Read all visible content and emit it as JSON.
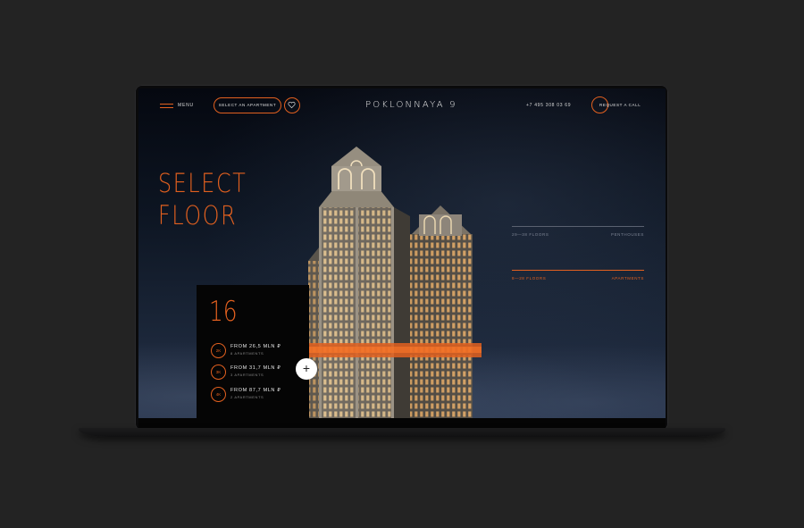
{
  "header": {
    "menu_label": "MENU",
    "select_apartment_label": "SELECT AN APARTMENT",
    "favorites_icon": "heart-icon",
    "brand": "POKLONNAYA 9",
    "phone": "+7 495 308 03 69",
    "request_call_label": "REQUEST A CALL"
  },
  "hero": {
    "headline_line1": "SELECT",
    "headline_line2": "FLOOR"
  },
  "floor_panel": {
    "floor_number": "16",
    "apartments": [
      {
        "badge": "2K",
        "price": "FROM 26,5 MLN ₽",
        "count": "8 APARTMENTS"
      },
      {
        "badge": "3K",
        "price": "FROM 31,7 MLN ₽",
        "count": "3 APARTMENTS"
      },
      {
        "badge": "4K",
        "price": "FROM 87,7 MLN ₽",
        "count": "2 APARTMENTS"
      }
    ]
  },
  "floor_links": [
    {
      "range": "29—38 FLOORS",
      "type": "PENTHOUSES",
      "active": false
    },
    {
      "range": "8—28 FLOORS",
      "type": "APARTMENTS",
      "active": true
    }
  ],
  "colors": {
    "accent": "#e2601f",
    "background": "#232323",
    "panel": "#050505"
  }
}
